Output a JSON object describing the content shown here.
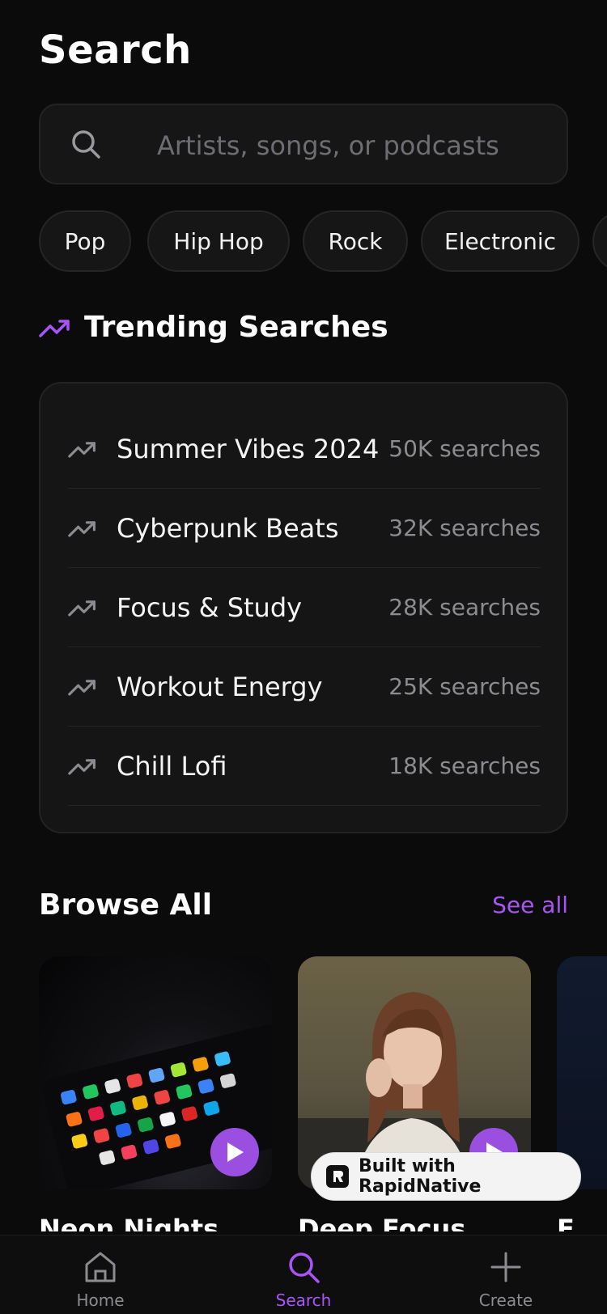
{
  "header": {
    "title": "Search"
  },
  "search": {
    "placeholder": "Artists, songs, or podcasts",
    "value": ""
  },
  "genres": [
    "Pop",
    "Hip Hop",
    "Rock",
    "Electronic"
  ],
  "trending": {
    "title": "Trending Searches",
    "items": [
      {
        "name": "Summer Vibes 2024",
        "count": "50K searches"
      },
      {
        "name": "Cyberpunk Beats",
        "count": "32K searches"
      },
      {
        "name": "Focus & Study",
        "count": "28K searches"
      },
      {
        "name": "Workout Energy",
        "count": "25K searches"
      },
      {
        "name": "Chill Lofi",
        "count": "18K searches"
      }
    ]
  },
  "browse": {
    "title": "Browse All",
    "see_all": "See all",
    "cards": [
      {
        "name": "Neon Nights",
        "image": "phone-apps-photo"
      },
      {
        "name": "Deep Focus",
        "image": "woman-portrait-photo"
      },
      {
        "name": "F",
        "image": "dark-photo"
      }
    ]
  },
  "badge": {
    "label": "Built with RapidNative"
  },
  "tabbar": {
    "items": [
      {
        "label": "Home",
        "icon": "home-icon",
        "active": false
      },
      {
        "label": "Search",
        "icon": "search-icon",
        "active": true
      },
      {
        "label": "Create",
        "icon": "plus-icon",
        "active": false
      }
    ]
  },
  "colors": {
    "accent": "#a855f7",
    "background": "#0b0b0c",
    "card": "#151516",
    "muted": "#8c8c90"
  }
}
